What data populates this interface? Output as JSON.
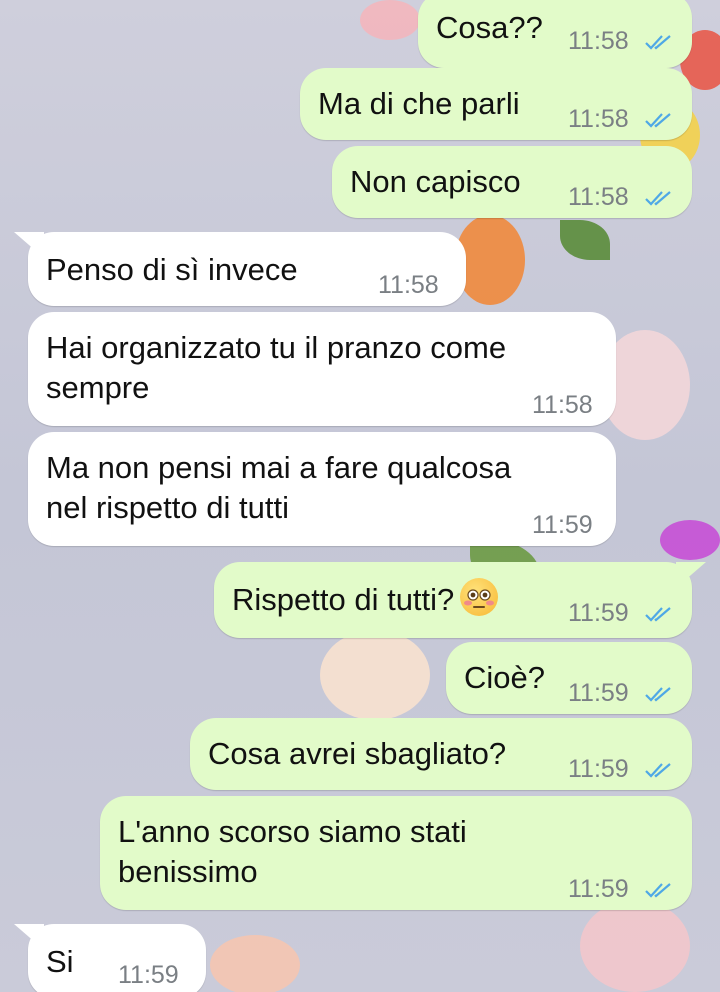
{
  "theme": {
    "outgoing_bubble": "#e2fbc9",
    "incoming_bubble": "#ffffff",
    "read_tick_color": "#4fa8e6"
  },
  "messages": [
    {
      "dir": "out",
      "text": "Cosa??",
      "time": "11:58",
      "status": "read-double-tick-icon"
    },
    {
      "dir": "out",
      "text": "Ma di che parli",
      "time": "11:58",
      "status": "read-double-tick-icon"
    },
    {
      "dir": "out",
      "text": "Non capisco",
      "time": "11:58",
      "status": "read-double-tick-icon"
    },
    {
      "dir": "in",
      "text": "Penso di sì invece",
      "time": "11:58"
    },
    {
      "dir": "in",
      "text_line1": "Hai organizzato tu il pranzo come",
      "text_line2": "sempre",
      "time": "11:58"
    },
    {
      "dir": "in",
      "text_line1": "Ma non pensi mai a fare qualcosa",
      "text_line2": "nel rispetto di tutti",
      "time": "11:59"
    },
    {
      "dir": "out",
      "text": "Rispetto di tutti?",
      "emoji": "flushed-face-emoji",
      "time": "11:59",
      "status": "read-double-tick-icon"
    },
    {
      "dir": "out",
      "text": "Cioè?",
      "time": "11:59",
      "status": "read-double-tick-icon"
    },
    {
      "dir": "out",
      "text": "Cosa avrei sbagliato?",
      "time": "11:59",
      "status": "read-double-tick-icon"
    },
    {
      "dir": "out",
      "text_line1": "L'anno scorso siamo stati",
      "text_line2": "benissimo",
      "time": "11:59",
      "status": "read-double-tick-icon"
    },
    {
      "dir": "in",
      "text": "Si",
      "time": "11:59"
    }
  ]
}
